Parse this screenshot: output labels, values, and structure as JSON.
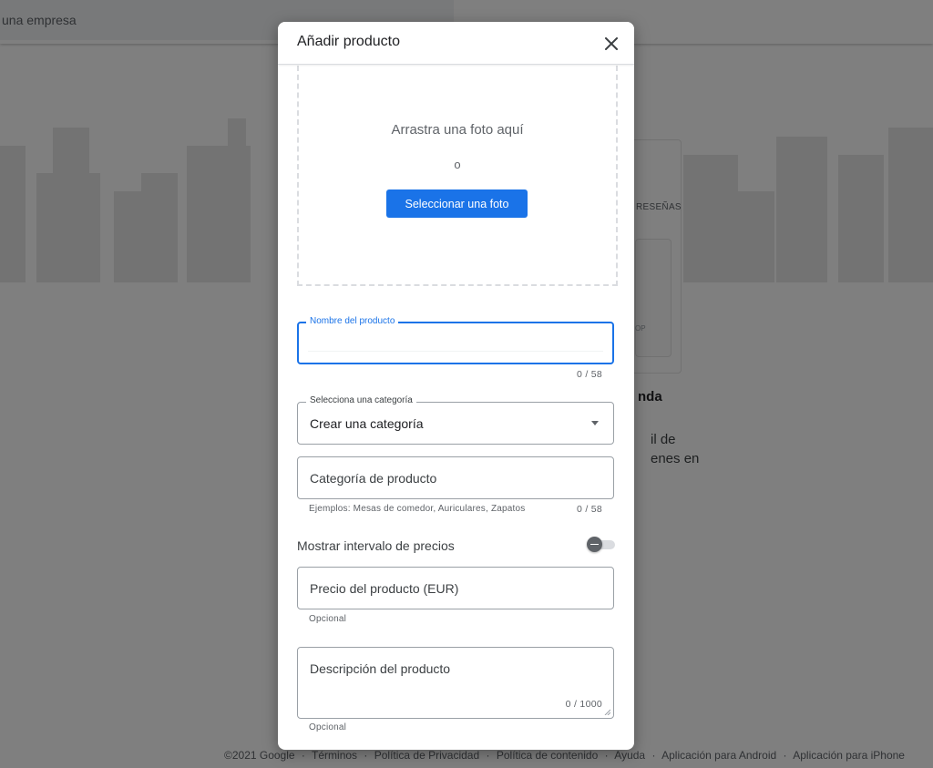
{
  "background": {
    "search_placeholder": "una empresa",
    "card_tab": "RESEÑAS",
    "card_text": "OP",
    "side_heading": "nda",
    "side_text": [
      "il de",
      "enes en"
    ],
    "footer": [
      "©2021 Google",
      "Términos",
      "Política de Privacidad",
      "Política de contenido",
      "Ayuda",
      "Aplicación para Android",
      "Aplicación para iPhone"
    ],
    "footer_separator": "·"
  },
  "dialog": {
    "title": "Añadir producto",
    "close_icon": "close-icon",
    "dropzone": {
      "text": "Arrastra una foto aquí",
      "or": "o",
      "button": "Seleccionar una foto"
    },
    "product_name": {
      "label": "Nombre del producto",
      "value": "",
      "counter": "0 / 58"
    },
    "category_select": {
      "label": "Selecciona una categoría",
      "value": "Crear una categoría"
    },
    "product_category": {
      "placeholder": "Categoría de producto",
      "helper": "Ejemplos: Mesas de comedor, Auriculares, Zapatos",
      "counter": "0 / 58"
    },
    "price_range": {
      "label": "Mostrar intervalo de precios",
      "enabled": false
    },
    "price": {
      "placeholder": "Precio del producto (EUR)",
      "helper": "Opcional"
    },
    "description": {
      "placeholder": "Descripción del producto",
      "counter": "0 / 1000",
      "helper": "Opcional"
    }
  },
  "colors": {
    "accent": "#1a73e8",
    "scrim": "rgba(0,0,0,0.5)"
  }
}
